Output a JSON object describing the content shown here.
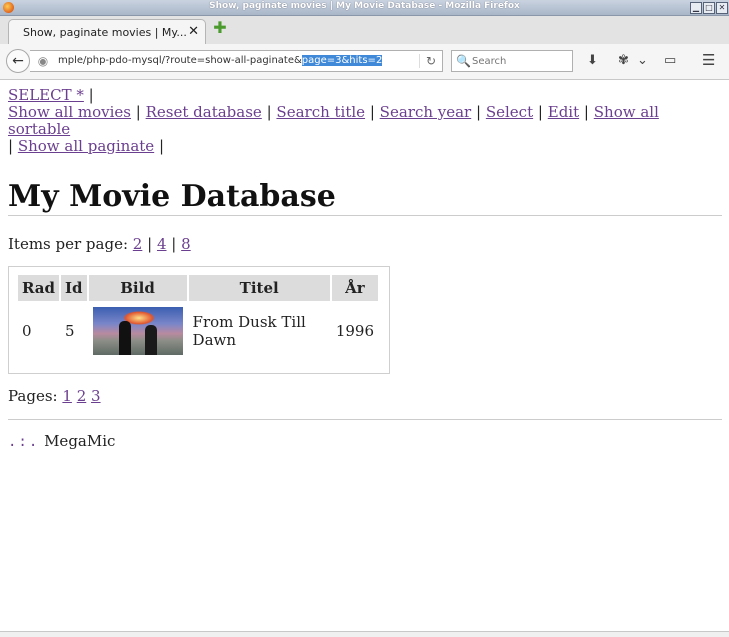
{
  "window": {
    "title": "Show, paginate movies | My Movie Database - Mozilla Firefox",
    "minimize_glyph": "▁",
    "maximize_glyph": "□",
    "close_glyph": "✕"
  },
  "tab": {
    "title": "Show, paginate movies | My...",
    "close_glyph": "✕"
  },
  "newtab": {
    "glyph": "✚"
  },
  "nav": {
    "url_plain": "mple/php-pdo-mysql/?route=show-all-paginate&",
    "url_selected": "page=3&hits=2",
    "search_placeholder": "Search"
  },
  "icons": {
    "back": "←",
    "globe": "◉",
    "reload": "↻",
    "search": "🔍",
    "download": "⬇",
    "plugin": "✾",
    "dropdown": "⌄",
    "screen": "▭",
    "menu": "☰"
  },
  "page": {
    "links": [
      "SELECT *",
      "Show all movies",
      "Reset database",
      "Search title",
      "Search year",
      "Select",
      "Edit",
      "Show all sortable",
      "Show all paginate"
    ],
    "separator": "|",
    "heading": "My Movie Database",
    "perpage_label": "Items per page:",
    "perpage_options": [
      "2",
      "4",
      "8"
    ],
    "table": {
      "headers": [
        "Rad",
        "Id",
        "Bild",
        "Titel",
        "År"
      ],
      "rows": [
        {
          "rad": "0",
          "id": "5",
          "titel": "From Dusk Till Dawn",
          "ar": "1996"
        }
      ]
    },
    "pages_label": "Pages:",
    "pages": [
      "1",
      "2",
      "3"
    ],
    "footer_dots": ".:.",
    "footer_text": "MegaMic"
  }
}
